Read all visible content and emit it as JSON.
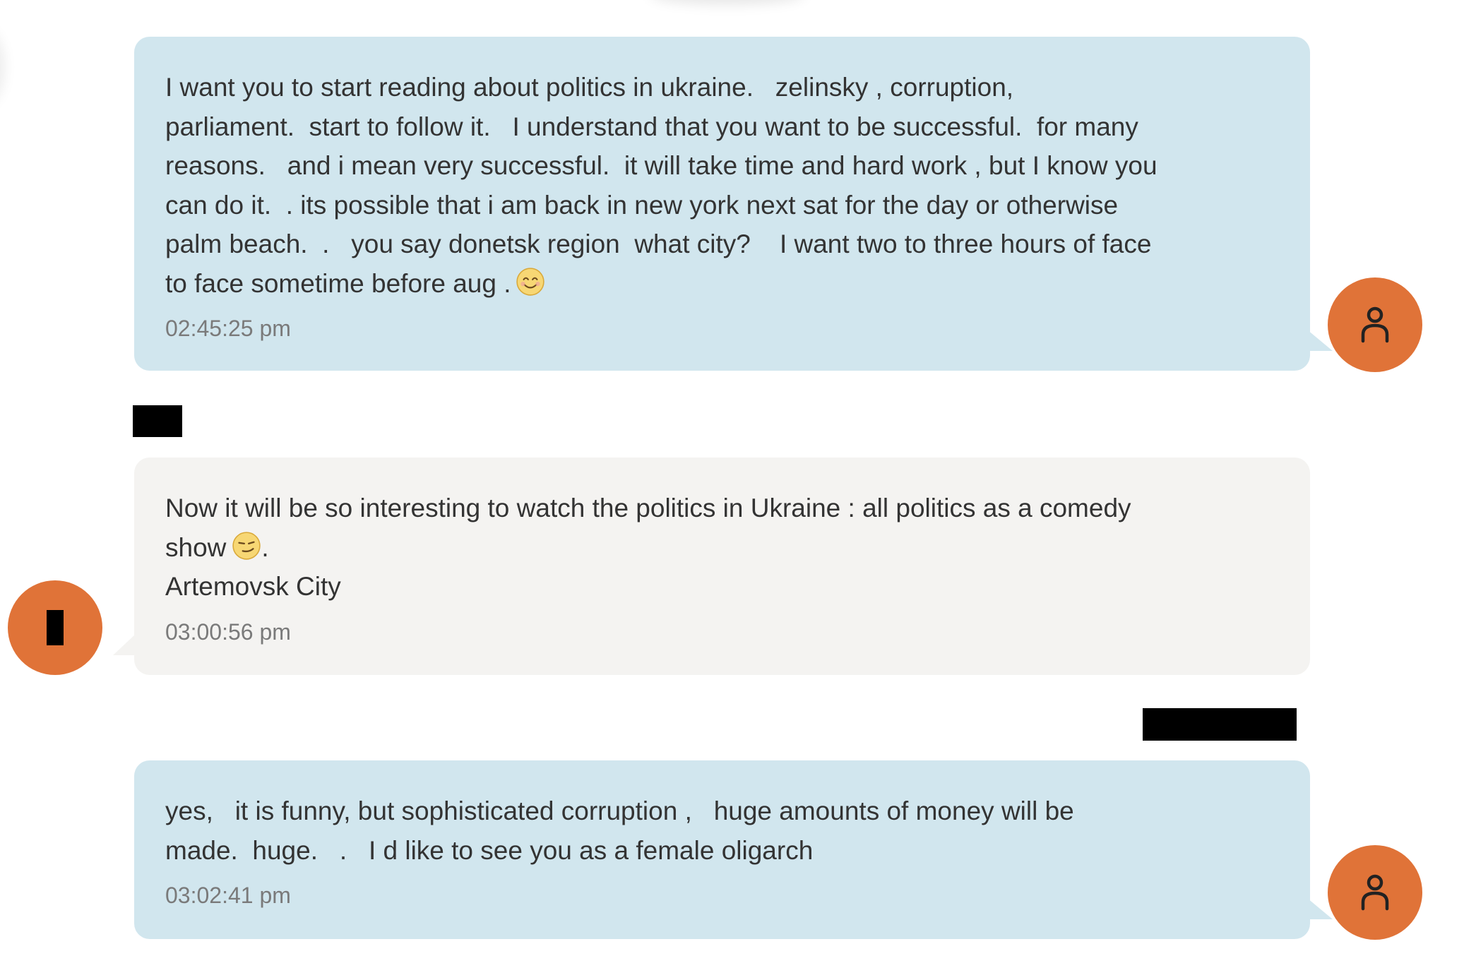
{
  "colors": {
    "sent_bubble": "#d1e6ee",
    "received_bubble": "#f4f3f1",
    "avatar_orange": "#e07338",
    "text": "#333333",
    "time": "#7a7a7a",
    "redaction": "#000000"
  },
  "messages": [
    {
      "direction": "sent",
      "text": "I want you to start reading about politics in ukraine.   zelinsky , corruption,\nparliament.  start to follow it.   I understand that you want to be successful.  for many\nreasons.   and i mean very successful.  it will take time and hard work , but I know you\ncan do it.  . its possible that i am back in new york next sat for the day or otherwise\npalm beach.  .   you say donetsk region  what city?    I want two to three hours of face\nto face sometime before aug .",
      "emoji": "smiling-face-emoji",
      "time": "02:45:25 pm",
      "avatar_icon": "person-icon"
    },
    {
      "direction": "received",
      "text": "Now it will be so interesting to watch the politics in Ukraine : all politics as a comedy\nshow",
      "emoji": "smirking-face-emoji",
      "text_after_emoji": ".\nArtemovsk City",
      "time": "03:00:56 pm",
      "avatar_icon": "redacted-avatar"
    },
    {
      "direction": "sent",
      "text": "yes,   it is funny, but sophisticated corruption ,   huge amounts of money will be\nmade.  huge.   .   I d like to see you as a female oligarch",
      "time": "03:02:41 pm",
      "avatar_icon": "person-icon"
    }
  ]
}
